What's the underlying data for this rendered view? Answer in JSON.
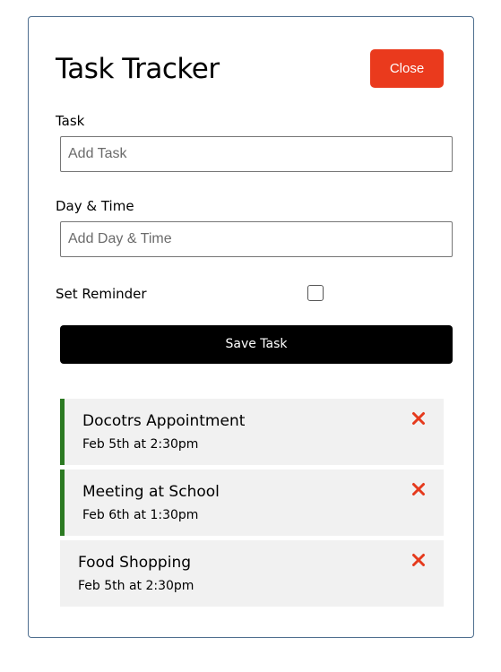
{
  "header": {
    "title": "Task Tracker",
    "close_label": "Close"
  },
  "form": {
    "task_label": "Task",
    "task_placeholder": "Add Task",
    "day_label": "Day & Time",
    "day_placeholder": "Add Day & Time",
    "reminder_label": "Set Reminder",
    "reminder_checked": false,
    "save_label": "Save Task"
  },
  "tasks": [
    {
      "text": "Docotrs Appointment",
      "day": "Feb 5th at 2:30pm",
      "reminder": true
    },
    {
      "text": "Meeting at School",
      "day": "Feb 6th at 1:30pm",
      "reminder": true
    },
    {
      "text": "Food Shopping",
      "day": "Feb 5th at 2:30pm",
      "reminder": false
    }
  ],
  "colors": {
    "close_button": "#ea3a1d",
    "save_button": "#000000",
    "reminder_border": "#2c7a22",
    "delete_icon": "#e53a1d",
    "task_background": "#f1f1f1",
    "card_border": "#4f6f8f"
  },
  "icons": {
    "delete": "times-icon"
  }
}
